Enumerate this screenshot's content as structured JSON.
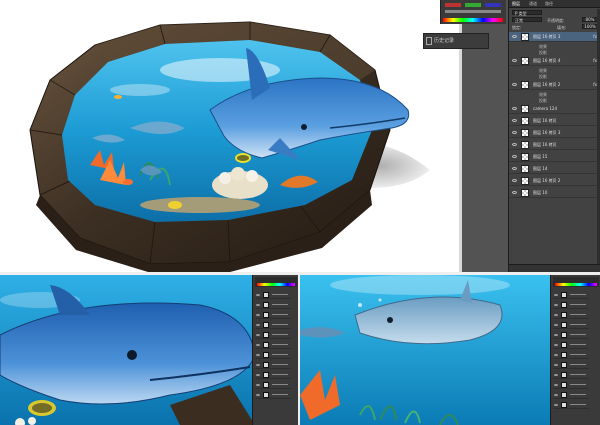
{
  "history_panel": {
    "item_label": "历史记录"
  },
  "layers_panel": {
    "tabs": [
      "图层",
      "通道",
      "路径"
    ],
    "kind_label": "P 类型",
    "blend_mode": "正常",
    "opacity_label": "不透明度:",
    "opacity_value": "80%",
    "lock_label": "锁定:",
    "fill_label": "填充:",
    "fill_value": "100%",
    "layers": [
      {
        "name": "图层 16 拷贝 3",
        "type": "layer",
        "fx": true,
        "selected": true
      },
      {
        "name": "效果",
        "type": "effects"
      },
      {
        "name": "投影",
        "type": "effect"
      },
      {
        "name": "图层 16 拷贝 4",
        "type": "layer",
        "fx": true
      },
      {
        "name": "效果",
        "type": "effects"
      },
      {
        "name": "投影",
        "type": "effect"
      },
      {
        "name": "图层 16 拷贝 2",
        "type": "layer",
        "fx": true
      },
      {
        "name": "效果",
        "type": "effects"
      },
      {
        "name": "投影",
        "type": "effect"
      },
      {
        "name": "camera 124",
        "type": "layer"
      },
      {
        "name": "图层 16 拷贝",
        "type": "layer"
      },
      {
        "name": "图层 16 拷贝 3",
        "type": "layer"
      },
      {
        "name": "图层 16 拷贝",
        "type": "layer"
      },
      {
        "name": "图层 15",
        "type": "layer"
      },
      {
        "name": "图层 14",
        "type": "layer"
      },
      {
        "name": "图层 16 拷贝 2",
        "type": "layer"
      },
      {
        "name": "图层 10",
        "type": "layer"
      }
    ]
  },
  "colors": {
    "water": "#1a9fd6",
    "stone": "#4a3b2c",
    "panel": "#424242"
  }
}
